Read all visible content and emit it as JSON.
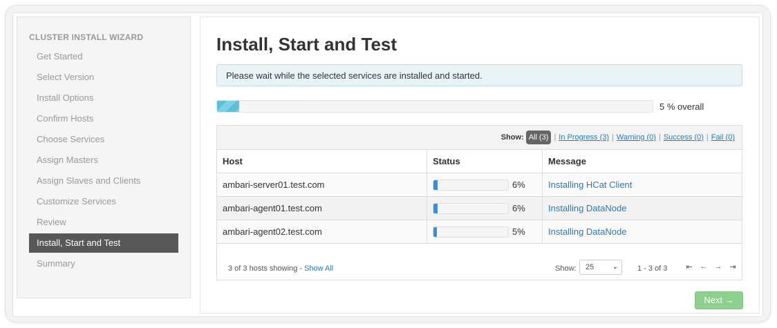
{
  "sidebar": {
    "title": "CLUSTER INSTALL WIZARD",
    "steps": [
      {
        "label": "Get Started"
      },
      {
        "label": "Select Version"
      },
      {
        "label": "Install Options"
      },
      {
        "label": "Confirm Hosts"
      },
      {
        "label": "Choose Services"
      },
      {
        "label": "Assign Masters"
      },
      {
        "label": "Assign Slaves and Clients"
      },
      {
        "label": "Customize Services"
      },
      {
        "label": "Review"
      },
      {
        "label": "Install, Start and Test",
        "active": true
      },
      {
        "label": "Summary"
      }
    ]
  },
  "main": {
    "title": "Install, Start and Test",
    "alert": "Please wait while the selected services are installed and started.",
    "overall_progress": 5,
    "overall_text": "5 % overall"
  },
  "filters": {
    "show_label": "Show:",
    "all": "All (3)",
    "in_progress": "In Progress (3)",
    "warning": "Warning (0)",
    "success": "Success (0)",
    "fail": "Fail (0)",
    "separator": "|"
  },
  "table": {
    "headers": {
      "host": "Host",
      "status": "Status",
      "message": "Message"
    },
    "rows": [
      {
        "host": "ambari-server01.test.com",
        "progress": 6,
        "pct": "6%",
        "message": "Installing HCat Client"
      },
      {
        "host": "ambari-agent01.test.com",
        "progress": 6,
        "pct": "6%",
        "message": "Installing DataNode"
      },
      {
        "host": "ambari-agent02.test.com",
        "progress": 5,
        "pct": "5%",
        "message": "Installing DataNode"
      }
    ]
  },
  "footer": {
    "hosts_showing": "3 of 3 hosts showing - ",
    "show_all": "Show All",
    "show_label": "Show:",
    "per_page": "25",
    "range": "1 - 3 of 3",
    "pager_icons": [
      "first-page-icon",
      "prev-page-icon",
      "next-page-icon",
      "last-page-icon"
    ]
  },
  "next_button": "Next →",
  "colors": {
    "active_step": "#585858",
    "progress_overall": "#5bc0de",
    "progress_host": "#3b8fd6",
    "link": "#2a7ab8",
    "next_button": "#8dd08d",
    "alert_bg": "#e8f4f8"
  }
}
